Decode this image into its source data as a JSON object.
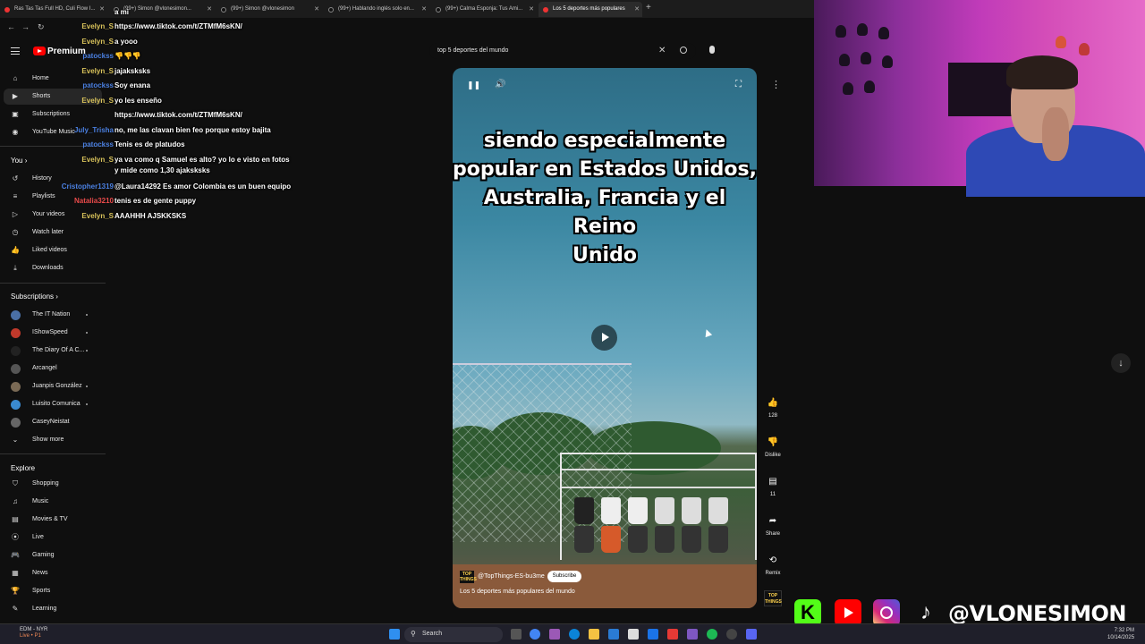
{
  "browser": {
    "tabs": [
      {
        "label": "Ras Tas Tas Full HD, Culi Flow I...",
        "active": false
      },
      {
        "label": "(99+) Simon @vlonesimon...",
        "active": false
      },
      {
        "label": "(99+) Simon @vlonesimon",
        "active": false
      },
      {
        "label": "(99+) Hablando inglés solo en...",
        "active": false
      },
      {
        "label": "(99+) Calma Esponja: Tus Ami...",
        "active": false
      },
      {
        "label": "Los 5 deportes más populares",
        "active": true
      }
    ]
  },
  "youtube": {
    "brand": "Premium",
    "search_query": "top 5 deportes del mundo",
    "nav": [
      {
        "label": "Home",
        "icon": "home-icon"
      },
      {
        "label": "Shorts",
        "icon": "shorts-icon"
      },
      {
        "label": "Subscriptions",
        "icon": "subscriptions-icon"
      },
      {
        "label": "YouTube Music",
        "icon": "music-icon"
      }
    ],
    "you_header": "You",
    "you_items": [
      {
        "label": "History",
        "icon": "history-icon"
      },
      {
        "label": "Playlists",
        "icon": "playlists-icon"
      },
      {
        "label": "Your videos",
        "icon": "your-videos-icon"
      },
      {
        "label": "Watch later",
        "icon": "clock-icon"
      },
      {
        "label": "Liked videos",
        "icon": "thumbs-up-icon"
      },
      {
        "label": "Downloads",
        "icon": "download-icon"
      }
    ],
    "subs_header": "Subscriptions",
    "subscriptions": [
      {
        "label": "The IT Nation",
        "color": "#4a6fa5"
      },
      {
        "label": "IShowSpeed",
        "color": "#c0392b"
      },
      {
        "label": "The Diary Of A C...",
        "color": "#222222"
      },
      {
        "label": "Arcangel",
        "color": "#555555"
      },
      {
        "label": "Juanpis González",
        "color": "#7a6a55"
      },
      {
        "label": "Luisito Comunica",
        "color": "#3a8ad0"
      },
      {
        "label": "CaseyNeistat",
        "color": "#666666"
      }
    ],
    "show_more": "Show more",
    "explore_header": "Explore",
    "explore": [
      {
        "label": "Shopping",
        "icon": "shopping-icon"
      },
      {
        "label": "Music",
        "icon": "music-note-icon"
      },
      {
        "label": "Movies & TV",
        "icon": "movies-icon"
      },
      {
        "label": "Live",
        "icon": "live-icon"
      },
      {
        "label": "Gaming",
        "icon": "gaming-icon"
      },
      {
        "label": "News",
        "icon": "news-icon"
      },
      {
        "label": "Sports",
        "icon": "trophy-icon"
      },
      {
        "label": "Learning",
        "icon": "learning-icon"
      }
    ]
  },
  "chat": [
    {
      "user": "",
      "message": "a mi",
      "color": "#e84a4a"
    },
    {
      "user": "Evelyn_S",
      "message": "https://www.tiktok.com/t/ZTMfM6sKN/",
      "color": "#d8c25a"
    },
    {
      "user": "Evelyn_S",
      "message": "a yooo",
      "color": "#d8c25a"
    },
    {
      "user": "patockss",
      "message": "👎👎👎",
      "color": "#4a7fe0"
    },
    {
      "user": "Evelyn_S",
      "message": "jajaksksks",
      "color": "#d8c25a"
    },
    {
      "user": "patockss",
      "message": "Soy enana",
      "color": "#4a7fe0"
    },
    {
      "user": "Evelyn_S",
      "message": "yo les enseño",
      "color": "#d8c25a"
    },
    {
      "user": "",
      "message": "https://www.tiktok.com/t/ZTMfM6sKN/",
      "color": "#e84a4a"
    },
    {
      "user": "July_Trisha",
      "message": "no, me las clavan bien feo porque estoy bajita",
      "color": "#4a7fe0"
    },
    {
      "user": "patockss",
      "message": "Tenis es de platudos",
      "color": "#4a7fe0"
    },
    {
      "user": "Evelyn_S",
      "message": "ya va como q Samuel es alto? yo lo e visto en fotos",
      "color": "#d8c25a"
    },
    {
      "user": "",
      "message": "y mide como 1,30 ajaksksks",
      "color": "#d8c25a"
    },
    {
      "user": "Cristopher1319",
      "message": "@Laura14292 Es amor Colombia es un buen equipo",
      "color": "#4a7fe0"
    },
    {
      "user": "Natalia3210",
      "message": "tenis es de gente puppy",
      "color": "#e84a4a"
    },
    {
      "user": "Evelyn_S",
      "message": "AAAHHH AJSKKSKS",
      "color": "#d8c25a"
    }
  ],
  "short": {
    "caption_lines": [
      "siendo especialmente",
      "popular en Estados Unidos,",
      "Australia, Francia y el Reino",
      "Unido"
    ],
    "channel": "@TopThings-ES-bu3me",
    "channel_badge": "TOP THINGS",
    "subscribe": "Subscribe",
    "title": "Los 5 deportes más populares del mundo",
    "likes": "128",
    "dislike": "Dislike",
    "comments": "11",
    "share": "Share",
    "remix": "Remix"
  },
  "overlay": {
    "handle": "@VLONESIMON"
  },
  "taskbar": {
    "search": "Search",
    "weather": "EDM - NYR",
    "weather_sub": "Live • P1",
    "time": "7:32 PM",
    "date": "10/14/2025"
  }
}
